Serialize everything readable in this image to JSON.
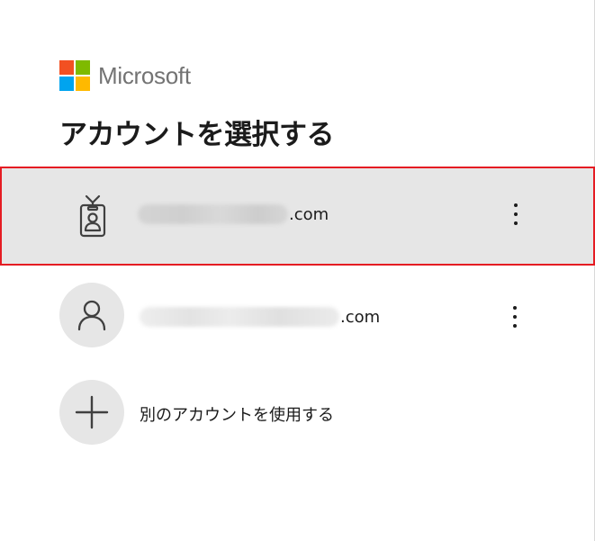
{
  "brand": {
    "name": "Microsoft",
    "colors": {
      "red": "#f25022",
      "green": "#7fba00",
      "blue": "#00a4ef",
      "yellow": "#ffb900",
      "text": "#737373"
    }
  },
  "heading": "アカウントを選択する",
  "accounts": [
    {
      "icon": "badge-id-icon",
      "email_suffix": ".com",
      "selected": true,
      "menu_label": "⋮"
    },
    {
      "icon": "person-icon",
      "email_suffix": ".com",
      "selected": false,
      "menu_label": "⋮"
    }
  ],
  "add_account": {
    "icon": "plus-icon",
    "label": "別のアカウントを使用する"
  },
  "highlight_color": "#e51c23"
}
